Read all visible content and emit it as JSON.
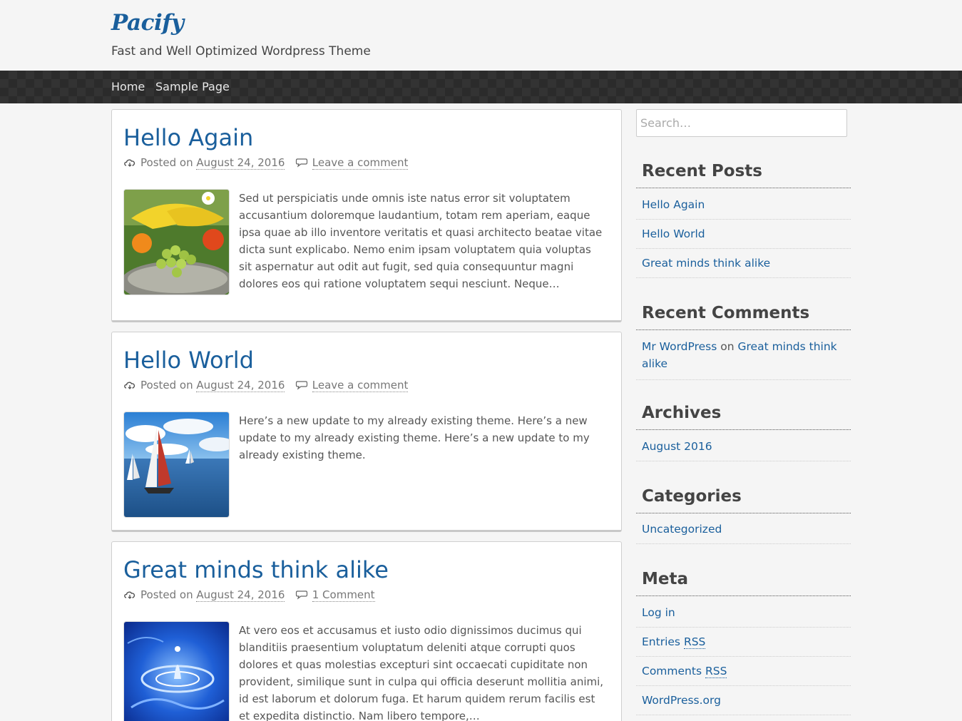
{
  "site": {
    "title": "Pacify",
    "tagline": "Fast and Well Optimized Wordpress Theme"
  },
  "nav": {
    "items": [
      {
        "label": "Home"
      },
      {
        "label": "Sample Page"
      }
    ]
  },
  "posts": [
    {
      "title": "Hello Again",
      "posted_on": "Posted on",
      "date": "August 24, 2016",
      "comments": "Leave a comment",
      "excerpt": "Sed ut perspiciatis unde omnis iste natus error sit voluptatem accusantium doloremque laudantium, totam rem aperiam, eaque ipsa quae ab illo inventore veritatis et quasi architecto beatae vitae dicta sunt explicabo. Nemo enim ipsam voluptatem quia voluptas sit aspernatur aut odit aut fugit, sed quia consequuntur magni dolores eos qui ratione voluptatem sequi nesciunt. Neque…"
    },
    {
      "title": "Hello World",
      "posted_on": "Posted on",
      "date": "August 24, 2016",
      "comments": "Leave a comment",
      "excerpt": "Here’s a new update to my already existing theme. Here’s a new update to my already existing theme. Here’s a new update to my already existing theme."
    },
    {
      "title": "Great minds think alike",
      "posted_on": "Posted on",
      "date": "August 24, 2016",
      "comments": "1 Comment",
      "excerpt": "At vero eos et accusamus et iusto odio dignissimos ducimus qui blanditiis praesentium voluptatum deleniti atque corrupti quos dolores et quas molestias excepturi sint occaecati cupiditate non provident, similique sunt in culpa qui officia deserunt mollitia animi, id est laborum et dolorum fuga. Et harum quidem rerum facilis est et expedita distinctio. Nam libero tempore,…"
    }
  ],
  "sidebar": {
    "search_placeholder": "Search…",
    "recent_posts": {
      "title": "Recent Posts",
      "items": [
        "Hello Again",
        "Hello World",
        "Great minds think alike"
      ]
    },
    "recent_comments": {
      "title": "Recent Comments",
      "author": "Mr WordPress",
      "on": "on",
      "post": "Great minds think alike"
    },
    "archives": {
      "title": "Archives",
      "items": [
        "August 2016"
      ]
    },
    "categories": {
      "title": "Categories",
      "items": [
        "Uncategorized"
      ]
    },
    "meta": {
      "title": "Meta",
      "log_in": "Log in",
      "entries": "Entries",
      "comments": "Comments",
      "rss": "RSS",
      "wordpress_org": "WordPress.org"
    }
  },
  "colors": {
    "link": "#1a5f9c",
    "nav_bg": "#2b2b2b"
  },
  "icons": {
    "meta_date": "cloud-icon",
    "meta_comments": "speech-bubble-icon"
  }
}
